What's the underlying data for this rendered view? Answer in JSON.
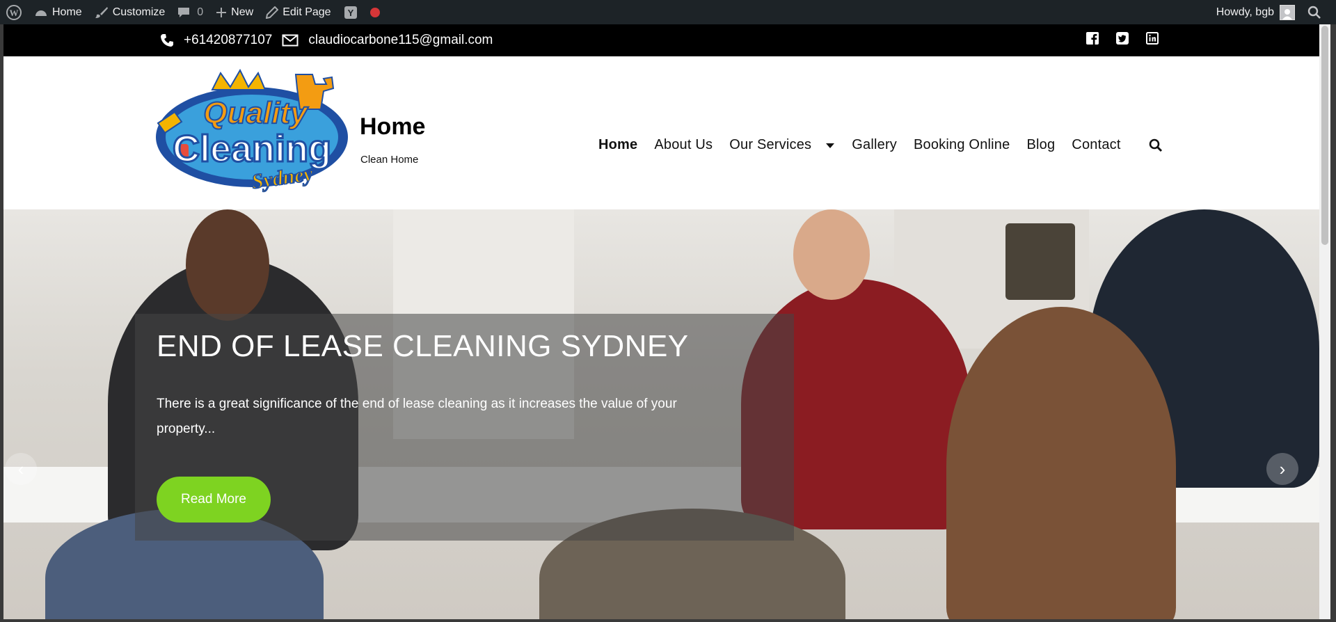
{
  "admin_bar": {
    "home": "Home",
    "customize": "Customize",
    "comments_count": "0",
    "new": "New",
    "edit_page": "Edit Page",
    "howdy": "Howdy, bgb"
  },
  "topbar": {
    "phone": "+61420877107",
    "email": "claudiocarbone115@gmail.com",
    "social_icons": [
      "facebook-icon",
      "twitter-icon",
      "linkedin-icon"
    ]
  },
  "header": {
    "logo_words": [
      "Quality",
      "Cleaning",
      "Sydney"
    ],
    "site_title": "Home",
    "tagline": "Clean Home"
  },
  "nav": {
    "items": [
      {
        "label": "Home",
        "active": true
      },
      {
        "label": "About Us",
        "active": false
      },
      {
        "label": "Our Services",
        "active": false
      },
      {
        "label": "Gallery",
        "active": false
      },
      {
        "label": "Booking Online",
        "active": false
      },
      {
        "label": "Blog",
        "active": false
      },
      {
        "label": "Contact",
        "active": false
      }
    ]
  },
  "hero": {
    "title": "END OF LEASE CLEANING SYDNEY",
    "text": "There is a great significance of the end of lease cleaning as it increases the value of your property...",
    "button": "Read More"
  },
  "colors": {
    "accent_green": "#7ed321",
    "admin_bar": "#1d2327",
    "topbar": "#000000"
  }
}
